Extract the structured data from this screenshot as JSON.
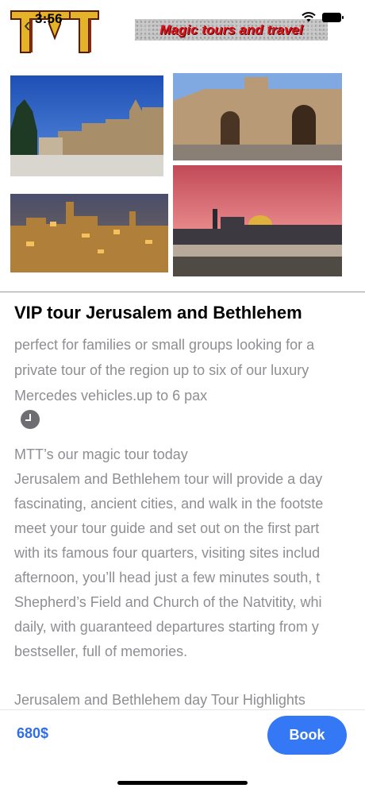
{
  "status": {
    "time": "3:56"
  },
  "header": {
    "brand_text": "Magic tours and travel"
  },
  "tour": {
    "title": "VIP tour Jerusalem and Bethlehem",
    "subtitle_lines": [
      "perfect for families or small groups looking for a",
      "private tour of the region up to six of our luxury",
      "Mercedes vehicles.up to 6 pax"
    ],
    "description_lines": [
      "MTT’s our magic tour today",
      "Jerusalem and Bethlehem tour will provide a day",
      "fascinating, ancient cities, and walk in the footste",
      "meet your tour guide and set out on the first part",
      "with its famous four quarters, visiting sites includ",
      "afternoon, you’ll head just a few minutes south, t",
      "Shepherd’s Field and Church of the Natvitity, whi",
      "daily, with guaranteed departures starting from y",
      "bestseller, full of memories."
    ],
    "highlights_heading": "Jerusalem and Bethlehem day Tour Highlights"
  },
  "footer": {
    "price": "680$",
    "book_label": "Book"
  },
  "icons": [
    "back-chevron-icon",
    "wifi-icon",
    "battery-icon",
    "clock-icon"
  ],
  "colors": {
    "accent": "#3478f6",
    "price": "#2f6fe3",
    "brand_red": "#e0141c"
  }
}
